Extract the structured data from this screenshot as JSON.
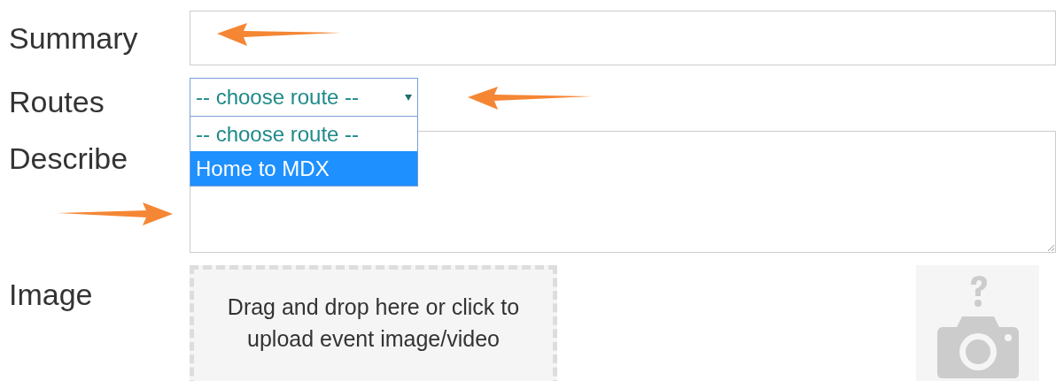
{
  "fields": {
    "summary": {
      "label": "Summary"
    },
    "routes": {
      "label": "Routes",
      "value": "-- choose route --",
      "expanded": true,
      "options": [
        {
          "label": "-- choose route --",
          "highlighted": false
        },
        {
          "label": "Home to MDX",
          "highlighted": true
        }
      ]
    },
    "describe": {
      "label": "Describe"
    },
    "image": {
      "label": "Image",
      "dropzone_text": "Drag and drop here or click to upload event image/video"
    }
  }
}
